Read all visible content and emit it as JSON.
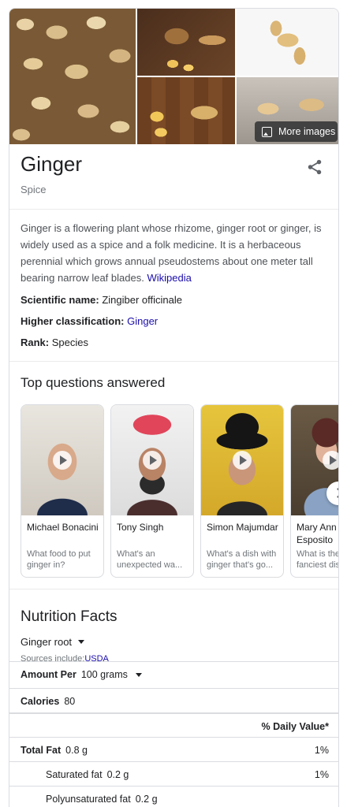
{
  "images": {
    "more_images_label": "More images"
  },
  "header": {
    "title": "Ginger",
    "subtitle": "Spice"
  },
  "description": {
    "text": "Ginger is a flowering plant whose rhizome, ginger root or ginger, is widely used as a spice and a folk medicine. It is a herbaceous perennial which grows annual pseudostems about one meter tall bearing narrow leaf blades.",
    "source_link": "Wikipedia"
  },
  "facts": [
    {
      "label": "Scientific name:",
      "value": "Zingiber officinale",
      "is_link": false
    },
    {
      "label": "Higher classification:",
      "value": "Ginger",
      "is_link": true
    },
    {
      "label": "Rank:",
      "value": "Species",
      "is_link": false
    }
  ],
  "questions": {
    "section_title": "Top questions answered",
    "cards": [
      {
        "name": "Michael Bonacini",
        "question": [
          "What food to put",
          "ginger in?"
        ]
      },
      {
        "name": "Tony Singh",
        "question": [
          "What's an",
          "unexpected wa..."
        ]
      },
      {
        "name": "Simon Majumdar",
        "question": [
          "What's a dish with",
          "ginger that's go..."
        ]
      },
      {
        "name": "Mary Ann Esposito",
        "question": [
          "What is the",
          "fanciest dis"
        ]
      }
    ]
  },
  "nutrition": {
    "title": "Nutrition Facts",
    "selected_food": "Ginger root",
    "sources_prefix": "Sources include:",
    "sources_link": "USDA",
    "amount_per_label": "Amount Per",
    "amount_per_value": "100 grams",
    "calories_label": "Calories",
    "calories_value": "80",
    "daily_value_header": "% Daily Value*",
    "rows": [
      {
        "label": "Total Fat",
        "amount": "0.8 g",
        "dv": "1%",
        "bold": true
      },
      {
        "label": "Saturated fat",
        "amount": "0.2 g",
        "dv": "1%",
        "bold": false
      },
      {
        "label": "Polyunsaturated fat",
        "amount": "0.2 g",
        "dv": "",
        "bold": false
      }
    ]
  },
  "colors": {
    "link": "#1a0dab",
    "secondary_text": "#70757a",
    "border": "#dadce0"
  }
}
